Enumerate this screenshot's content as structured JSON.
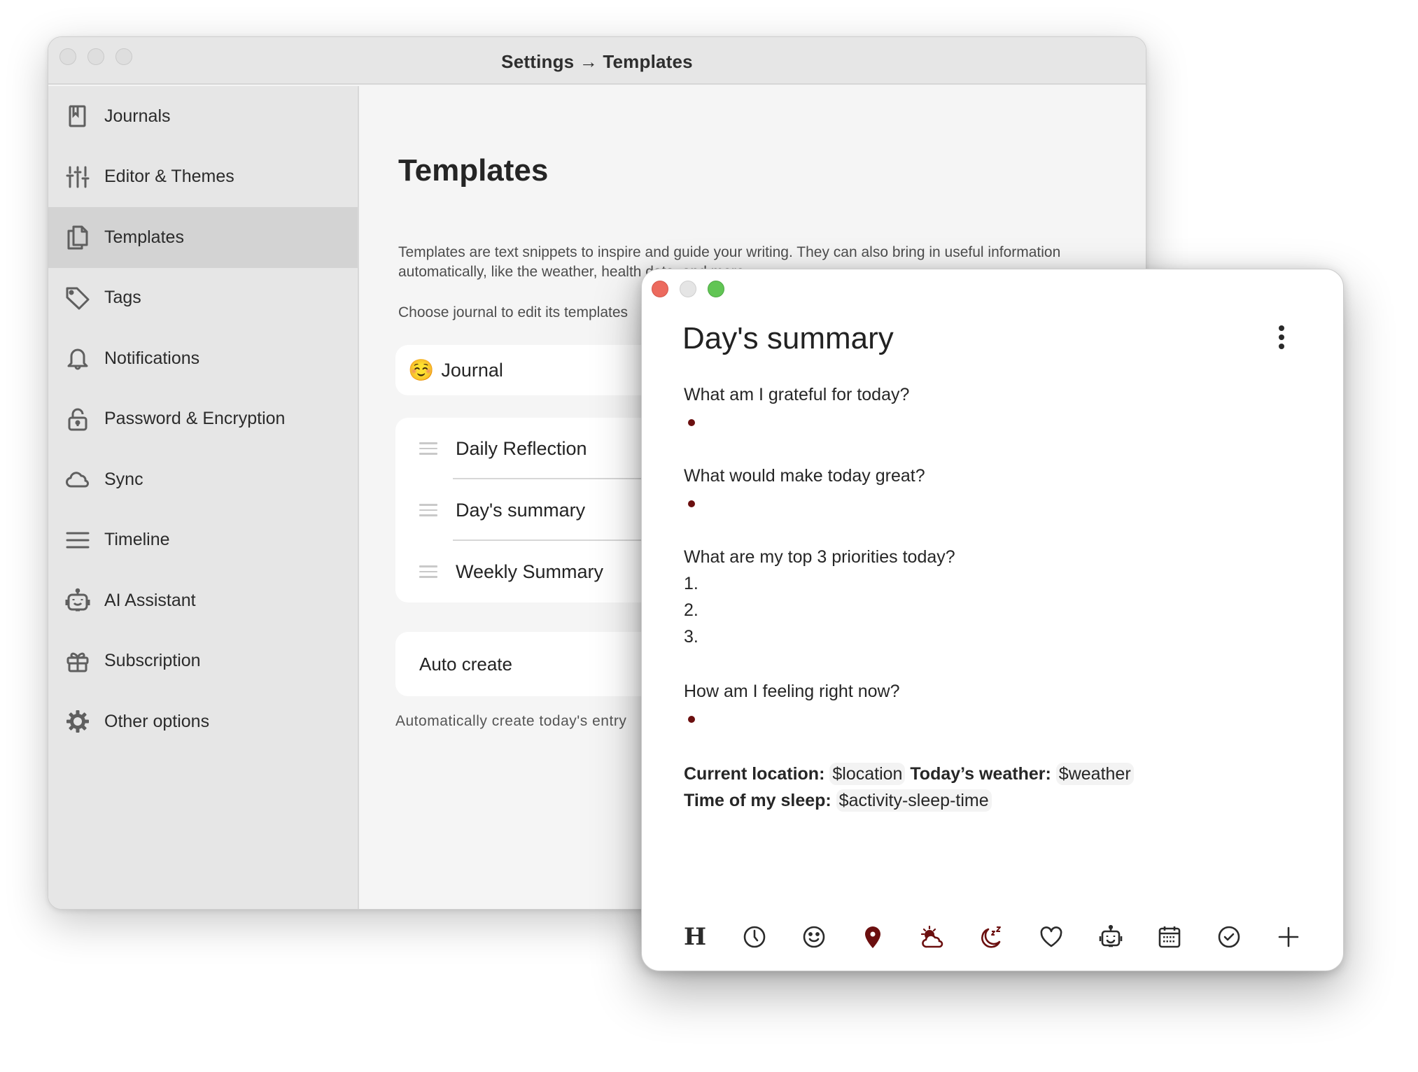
{
  "settings_window": {
    "title": "Settings → Templates",
    "sidebar": {
      "items": [
        {
          "label": "Journals",
          "icon": "journal-book-icon",
          "active": false
        },
        {
          "label": "Editor & Themes",
          "icon": "sliders-icon",
          "active": false
        },
        {
          "label": "Templates",
          "icon": "documents-icon",
          "active": true
        },
        {
          "label": "Tags",
          "icon": "tag-icon",
          "active": false
        },
        {
          "label": "Notifications",
          "icon": "bell-icon",
          "active": false
        },
        {
          "label": "Password & Encryption",
          "icon": "lock-icon",
          "active": false
        },
        {
          "label": "Sync",
          "icon": "cloud-icon",
          "active": false
        },
        {
          "label": "Timeline",
          "icon": "lines-icon",
          "active": false
        },
        {
          "label": "AI Assistant",
          "icon": "robot-icon",
          "active": false
        },
        {
          "label": "Subscription",
          "icon": "gift-icon",
          "active": false
        },
        {
          "label": "Other options",
          "icon": "gear-icon",
          "active": false
        }
      ]
    },
    "content": {
      "title": "Templates",
      "description": "Templates are text snippets to inspire and guide your writing. They can also bring in useful information automatically, like the weather, health data, and more.",
      "choose_label": "Choose journal to edit its templates",
      "journal": {
        "emoji": "☺️",
        "name": "Journal"
      },
      "templates": [
        {
          "name": "Daily Reflection"
        },
        {
          "name": "Day's summary"
        },
        {
          "name": "Weekly Summary"
        }
      ],
      "auto_create": {
        "label": "Auto create",
        "description": "Automatically create today's entry"
      }
    }
  },
  "editor_window": {
    "title": "Day's summary",
    "menu_icon": "more-vertical-icon",
    "sections": [
      {
        "question": "What am I grateful for today?",
        "type": "bullet",
        "items": 1
      },
      {
        "question": "What would make today great?",
        "type": "bullet",
        "items": 1
      },
      {
        "question": "What are my top 3 priorities today?",
        "type": "numbered",
        "items": [
          "1.",
          "2.",
          "3."
        ]
      },
      {
        "question": "How am I feeling right now?",
        "type": "bullet",
        "items": 1
      }
    ],
    "variables": {
      "location_label": "Current location:",
      "location_value": "$location",
      "weather_label": "Today’s weather:",
      "weather_value": "$weather",
      "sleep_label": "Time of my sleep:",
      "sleep_value": "$activity-sleep-time"
    },
    "toolbar": [
      {
        "name": "heading",
        "icon": "heading-icon",
        "glyph": "H"
      },
      {
        "name": "time",
        "icon": "clock-icon"
      },
      {
        "name": "mood",
        "icon": "smiley-icon"
      },
      {
        "name": "location",
        "icon": "location-pin-icon"
      },
      {
        "name": "weather",
        "icon": "weather-icon"
      },
      {
        "name": "sleep",
        "icon": "sleep-moon-icon"
      },
      {
        "name": "health",
        "icon": "heart-icon"
      },
      {
        "name": "ai",
        "icon": "robot-icon"
      },
      {
        "name": "calendar",
        "icon": "calendar-icon"
      },
      {
        "name": "todo",
        "icon": "check-circle-icon"
      },
      {
        "name": "add",
        "icon": "plus-icon"
      }
    ],
    "accent_color": "#6b0f0f"
  }
}
